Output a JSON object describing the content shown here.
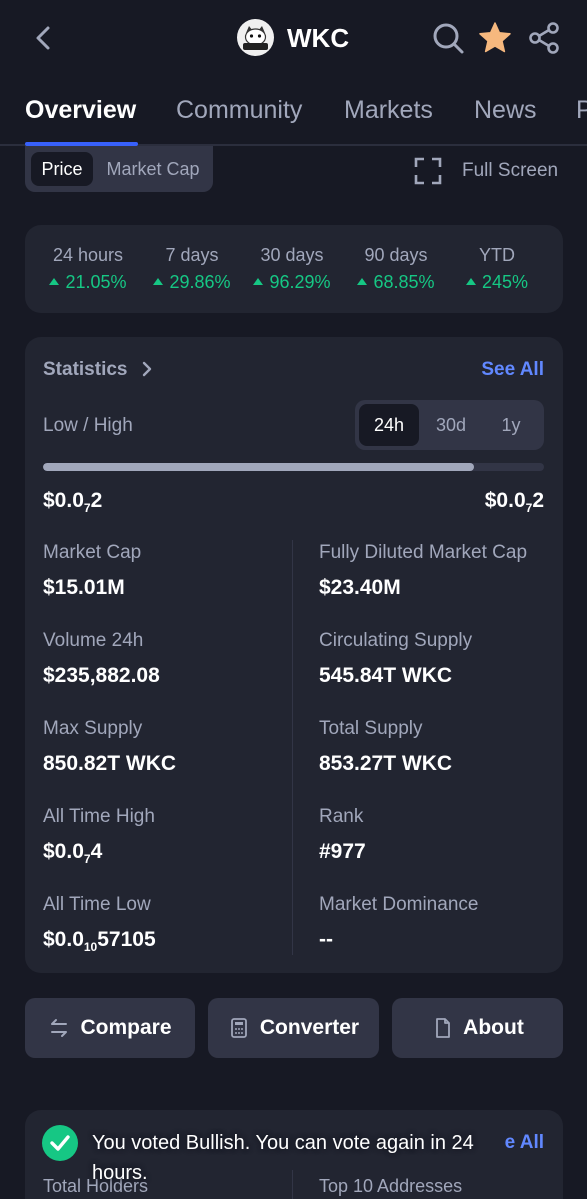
{
  "header": {
    "title": "WKC",
    "logo_text": "WIKI Cat"
  },
  "tabs": [
    "Overview",
    "Community",
    "Markets",
    "News",
    "P"
  ],
  "toggle": {
    "price": "Price",
    "market_cap": "Market Cap",
    "full_screen": "Full Screen"
  },
  "performance": [
    {
      "label": "24 hours",
      "value": "21.05%"
    },
    {
      "label": "7 days",
      "value": "29.86%"
    },
    {
      "label": "30 days",
      "value": "96.29%"
    },
    {
      "label": "90 days",
      "value": "68.85%"
    },
    {
      "label": "YTD",
      "value": "245%"
    }
  ],
  "stats": {
    "title": "Statistics",
    "see_all": "See All",
    "low_high_label": "Low / High",
    "ranges": [
      "24h",
      "30d",
      "1y"
    ],
    "range_progress_percent": 86,
    "low": {
      "prefix": "$0.0",
      "sub": "7",
      "suffix": "2"
    },
    "high": {
      "prefix": "$0.0",
      "sub": "7",
      "suffix": "2"
    },
    "left": [
      {
        "label": "Market Cap",
        "value": "$15.01M"
      },
      {
        "label": "Volume 24h",
        "value": "$235,882.08"
      },
      {
        "label": "Max Supply",
        "value": "850.82T WKC"
      },
      {
        "label": "All Time High",
        "value_prefix": "$0.0",
        "value_sub": "7",
        "value_suffix": "4"
      },
      {
        "label": "All Time Low",
        "value_prefix": "$0.0",
        "value_sub": "10",
        "value_suffix": "57105"
      }
    ],
    "right": [
      {
        "label": "Fully Diluted Market Cap",
        "value": "$23.40M"
      },
      {
        "label": "Circulating Supply",
        "value": "545.84T WKC"
      },
      {
        "label": "Total Supply",
        "value": "853.27T WKC"
      },
      {
        "label": "Rank",
        "value": "#977"
      },
      {
        "label": "Market Dominance",
        "value": "--"
      }
    ]
  },
  "actions": {
    "compare": "Compare",
    "converter": "Converter",
    "about": "About"
  },
  "bottom": {
    "see_all": "e All",
    "left_label": "Total Holders",
    "right_label": "Top 10 Addresses"
  },
  "toast": {
    "text": "You voted Bullish. You can vote again in 24 hours."
  },
  "colors": {
    "accent": "#3861fb",
    "link": "#6188ff",
    "up": "#16c784",
    "star": "#f6b87e"
  }
}
